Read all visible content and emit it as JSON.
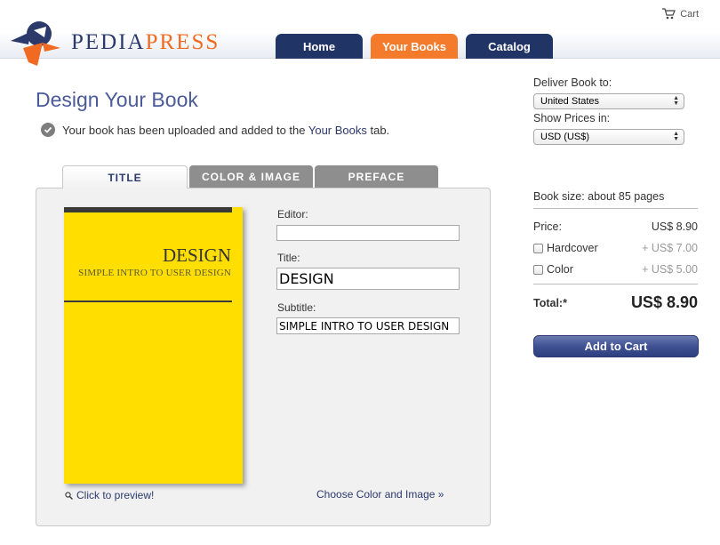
{
  "header": {
    "brand_part1": "PEDIA",
    "brand_part2": "PRESS",
    "cart_label": "Cart",
    "nav": {
      "home": "Home",
      "your_books": "Your Books",
      "catalog": "Catalog"
    },
    "colors": {
      "navy": "#213466",
      "orange": "#f47a2c"
    }
  },
  "main": {
    "title": "Design Your Book",
    "upload_message_prefix": "Your book has been uploaded and added to the ",
    "upload_message_link": "Your Books",
    "upload_message_suffix": " tab.",
    "tabs": {
      "title": "TITLE",
      "color_image": "COLOR & IMAGE",
      "preface": "PREFACE"
    },
    "cover": {
      "title": "DESIGN",
      "subtitle": "SIMPLE INTRO TO USER DESIGN",
      "color": "#ffde00"
    },
    "form": {
      "editor_label": "Editor:",
      "editor_value": "",
      "title_label": "Title:",
      "title_value": "DESIGN",
      "subtitle_label": "Subtitle:",
      "subtitle_value": "SIMPLE INTRO TO USER DESIGN"
    },
    "preview_link": "Click to preview!",
    "choose_link": "Choose Color and Image »"
  },
  "sidebar": {
    "deliver_label": "Deliver Book to:",
    "deliver_value": "United States",
    "prices_label": "Show Prices in:",
    "prices_value": "USD (US$)",
    "book_size": "Book size: about 85 pages",
    "price_label": "Price:",
    "price_value": "US$ 8.90",
    "hardcover_label": "Hardcover",
    "hardcover_price": "+ US$ 7.00",
    "color_label": "Color",
    "color_price": "+ US$ 5.00",
    "total_label": "Total:*",
    "total_value": "US$ 8.90",
    "add_to_cart": "Add to Cart"
  }
}
